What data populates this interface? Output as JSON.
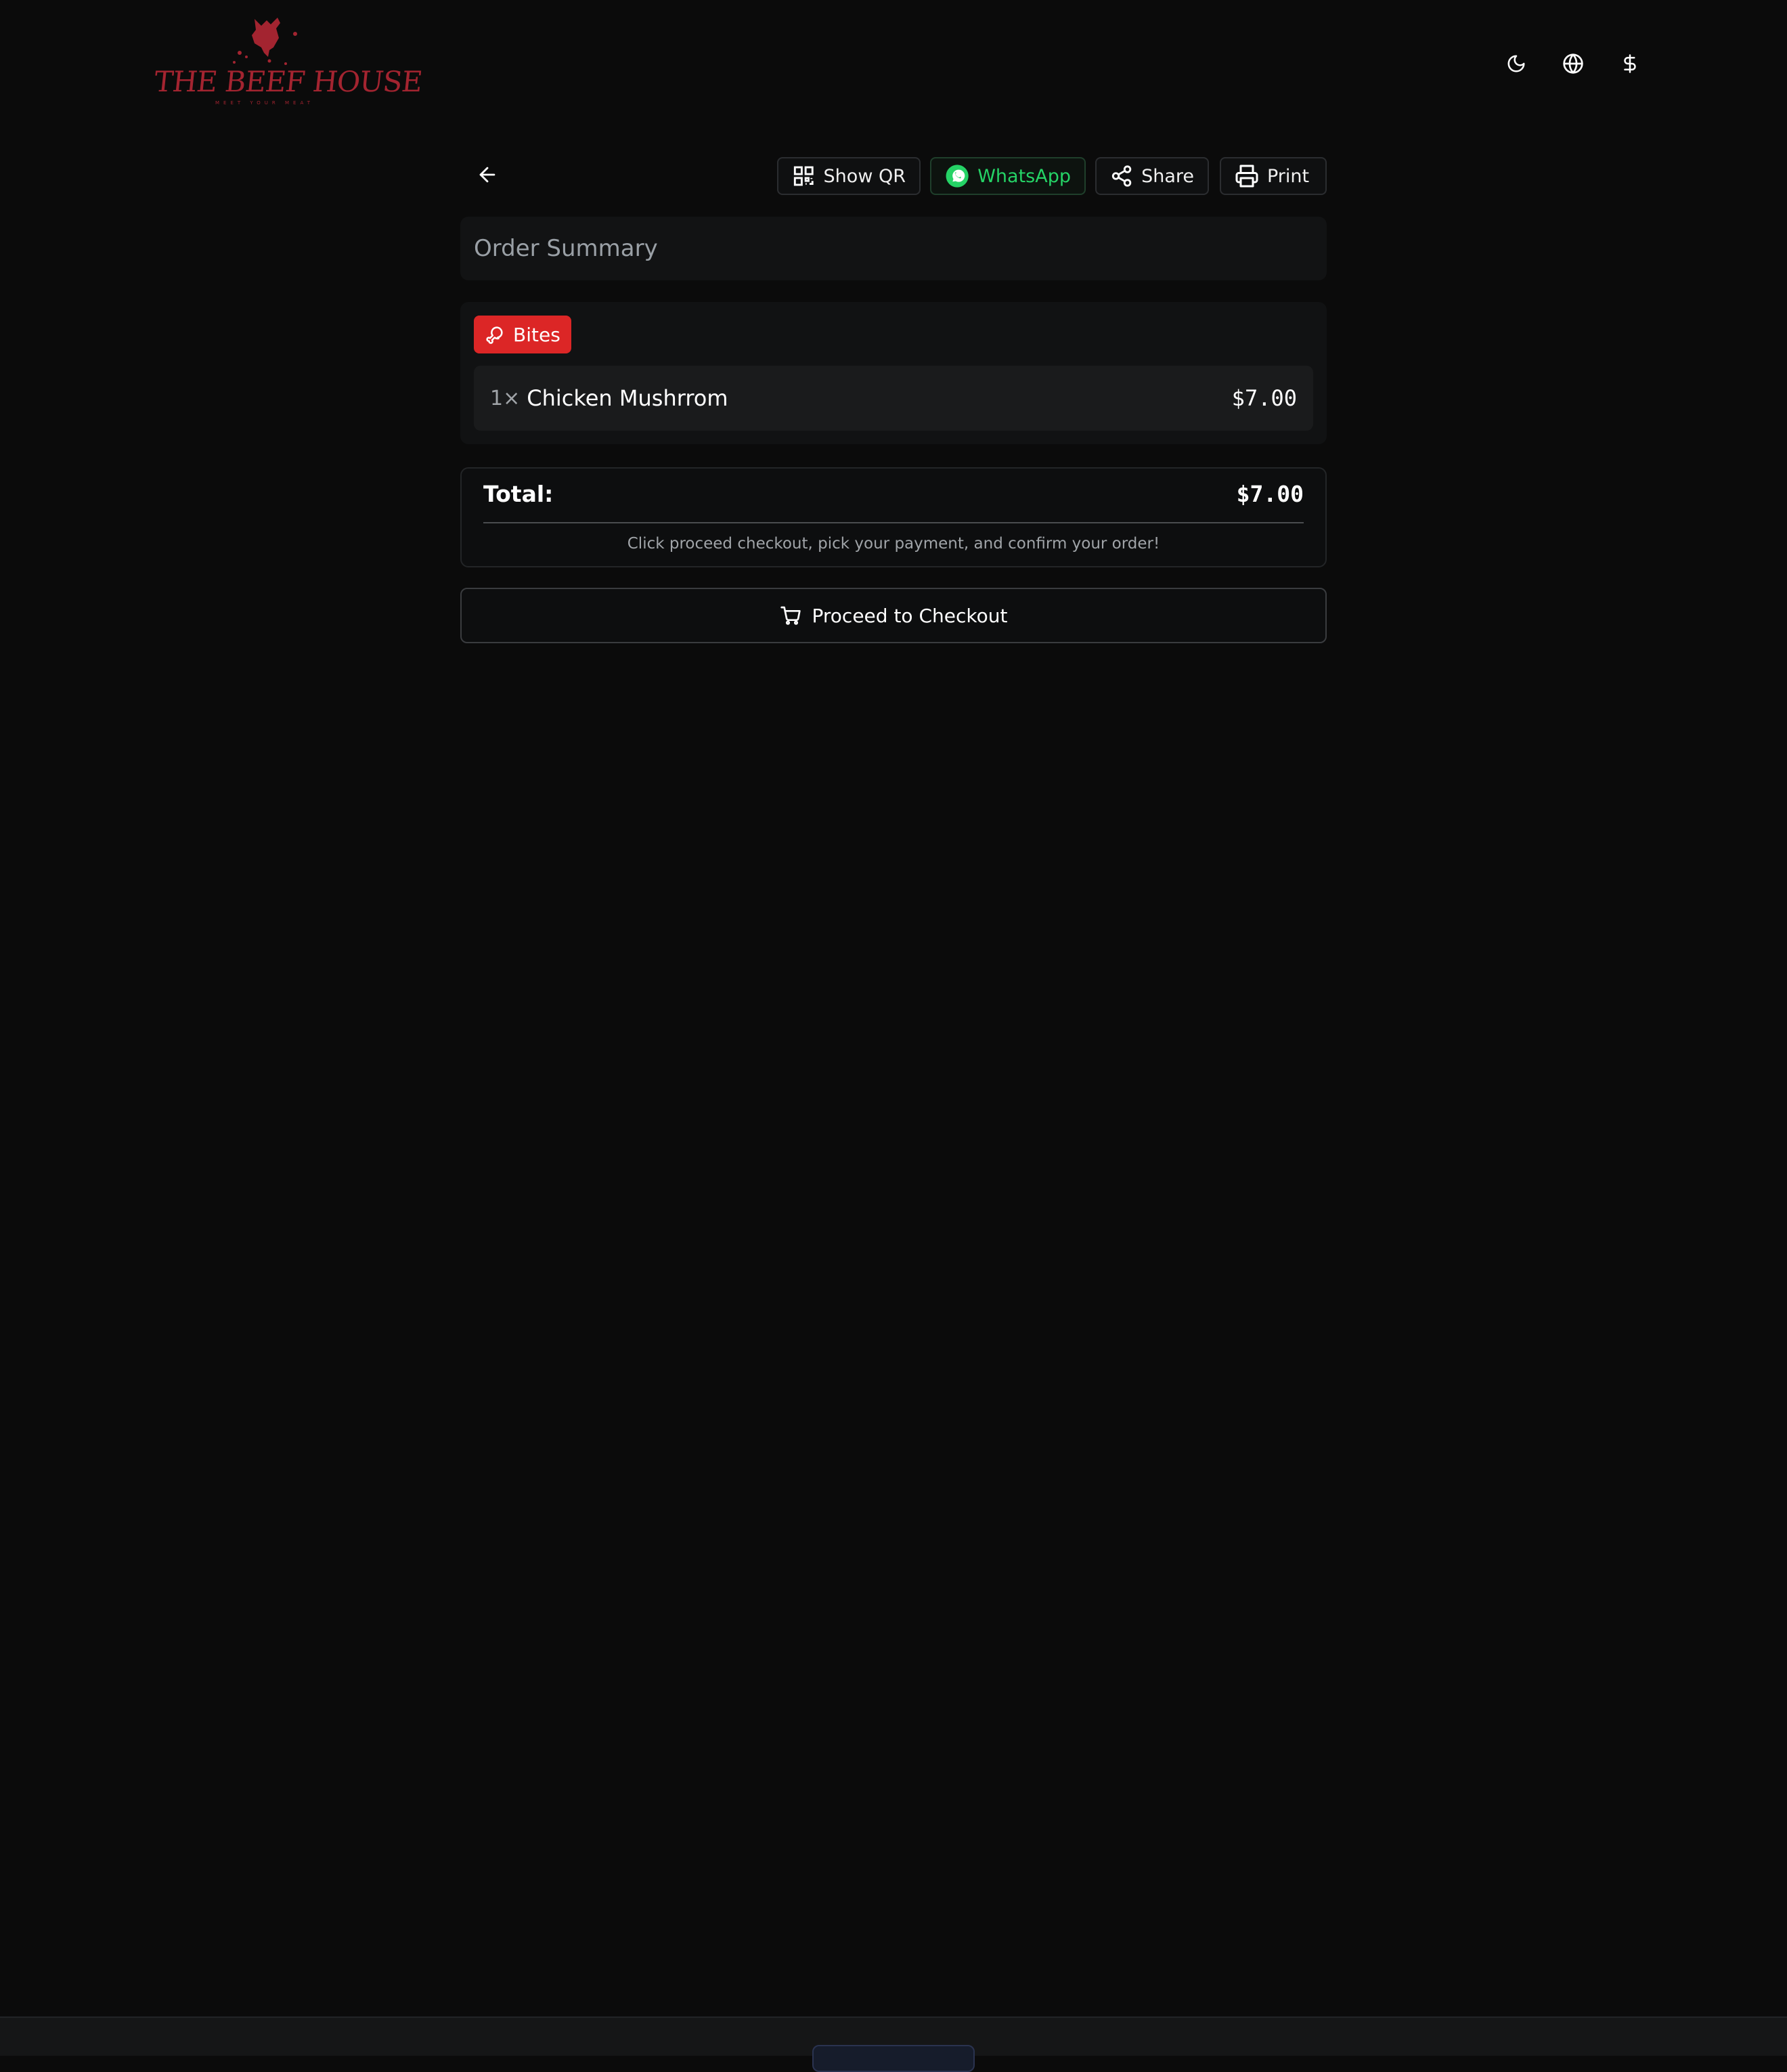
{
  "header": {
    "logo_text": "THE BEEF HOUSE",
    "logo_tagline": "MEET YOUR MEAT",
    "icons": [
      "moon-icon",
      "globe-icon",
      "dollar-icon"
    ]
  },
  "toolbar": {
    "show_qr_label": "Show QR",
    "whatsapp_label": "WhatsApp",
    "share_label": "Share",
    "print_label": "Print"
  },
  "summary": {
    "title": "Order Summary"
  },
  "categories": [
    {
      "name": "Bites",
      "items": [
        {
          "qty": "1×",
          "name": "Chicken Mushrrom",
          "price": "$7.00"
        }
      ]
    }
  ],
  "total": {
    "label": "Total:",
    "value": "$7.00",
    "hint": "Click proceed checkout, pick your payment, and confirm your order!"
  },
  "checkout": {
    "label": "Proceed to Checkout"
  },
  "colors": {
    "background": "#0b0b0b",
    "brand_red": "#a32430",
    "category_red": "#dc2626",
    "whatsapp_green": "#25d366"
  }
}
